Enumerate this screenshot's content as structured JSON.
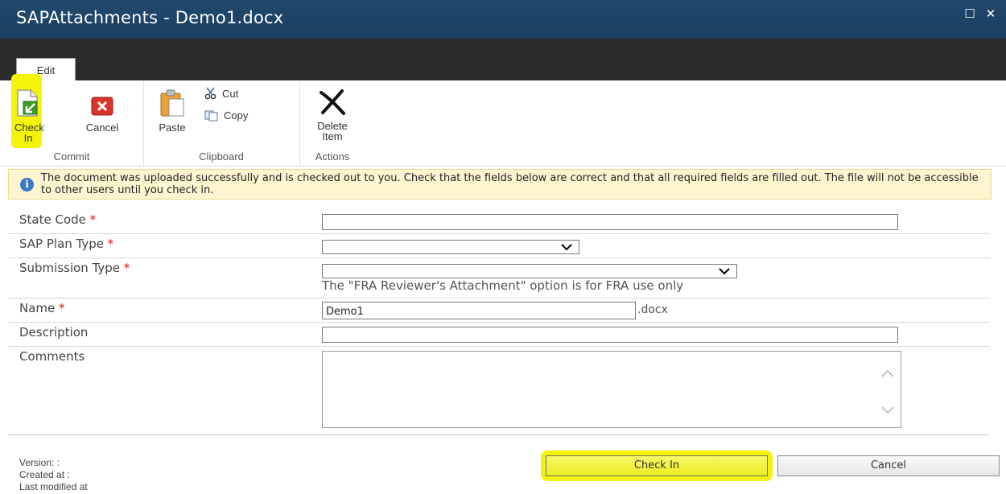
{
  "window": {
    "title": "SAPAttachments - Demo1.docx",
    "maximize_glyph": "☐",
    "close_glyph": "✕"
  },
  "ribbon": {
    "tab_label": "Edit",
    "groups": [
      {
        "label": "Commit",
        "buttons": [
          {
            "label": "Check In",
            "icon": "check-in-icon"
          },
          {
            "label": "Cancel",
            "icon": "cancel-icon"
          }
        ]
      },
      {
        "label": "Clipboard",
        "buttons": [
          {
            "label": "Paste",
            "icon": "paste-icon"
          },
          {
            "label": "Cut",
            "icon": "scissors-icon"
          },
          {
            "label": "Copy",
            "icon": "copy-icon"
          }
        ]
      },
      {
        "label": "Actions",
        "buttons": [
          {
            "label": "Delete Item",
            "icon": "delete-x-icon"
          }
        ]
      }
    ]
  },
  "info": {
    "icon": "info-icon",
    "glyph": "i",
    "message": "The document was uploaded successfully and is checked out to you. Check that the fields below are correct and that all required fields are filled out. The file will not be accessible to other users until you check in."
  },
  "form": {
    "required_mark": "*",
    "state_code": {
      "label": "State Code",
      "value": ""
    },
    "sap_plan_type": {
      "label": "SAP Plan Type",
      "value": ""
    },
    "submission_type": {
      "label": "Submission Type",
      "value": "",
      "hint": "The \"FRA Reviewer's Attachment\" option is for FRA use only"
    },
    "name": {
      "label": "Name",
      "value": "Demo1",
      "suffix": ".docx"
    },
    "description": {
      "label": "Description",
      "value": ""
    },
    "comments": {
      "label": "Comments",
      "value": ""
    }
  },
  "footer": {
    "version": "Version: :",
    "created": "Created at :",
    "modified": "Last modified at"
  },
  "actions": {
    "check_in": "Check In",
    "cancel": "Cancel"
  },
  "colors": {
    "titlebar": "#1f4467",
    "highlight": "#f4f40a",
    "info_bg": "#fdf5cf",
    "required": "#e01111"
  }
}
